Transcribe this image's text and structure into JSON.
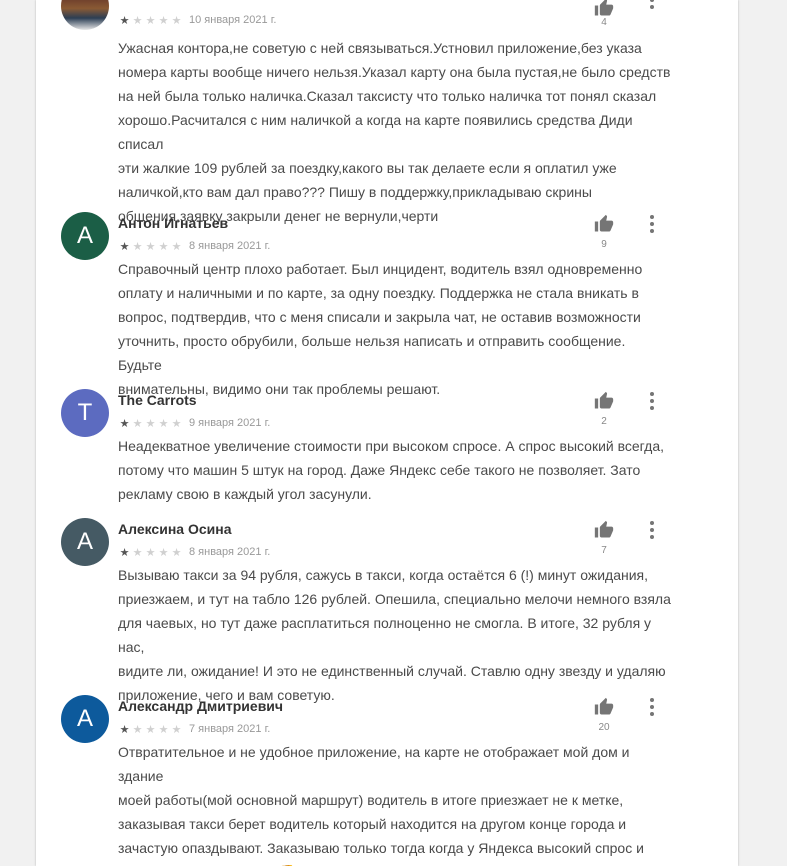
{
  "reviews": [
    {
      "author": "",
      "avatar_letter": "",
      "avatar_color": "#5a4a3a",
      "rating": 1,
      "date": "10 января 2021 г.",
      "helpful_count": "4",
      "text": "Ужасная контора,не советую с ней связываться.Устновил приложение,без указа\nномера карты вообще ничего нельзя.Указал карту она была пустая,не было средств\nна ней была только наличка.Сказал таксисту что только наличка тот понял сказал\nхорошо.Расчитался с ним наличкой а когда на карте появились средства Диди списал\nэти жалкие 109 рублей за поездку,какого вы так делаете если я оплатил уже\nналичкой,кто вам дал право??? Пишу в поддержку,прикладываю скрины\nобщения,заявку закрыли денег не вернули,черти"
    },
    {
      "author": "Антон Игнатьев",
      "avatar_letter": "А",
      "avatar_color": "#1b5e46",
      "rating": 1,
      "date": "8 января 2021 г.",
      "helpful_count": "9",
      "text": "Справочный центр плохо работает. Был инцидент, водитель взял одновременно\nоплату и наличными и по карте, за одну поездку. Поддержка не стала вникать в\nвопрос, подтвердив, что с меня списали и закрыла чат, не оставив возможности\nуточнить, просто обрубили, больше нельзя написать и отправить сообщение. Будьте\nвнимательны, видимо они так проблемы решают."
    },
    {
      "author": "The Carrots",
      "avatar_letter": "T",
      "avatar_color": "#5c6bc0",
      "rating": 1,
      "date": "9 января 2021 г.",
      "helpful_count": "2",
      "text": "Неадекватное увеличение стоимости при высоком спросе. А спрос высокий всегда,\nпотому что машин 5 штук на город. Даже Яндекс себе такого не позволяет. Зато\nрекламу свою в каждый угол засунули."
    },
    {
      "author": "Алексина Осина",
      "avatar_letter": "А",
      "avatar_color": "#455a64",
      "rating": 1,
      "date": "8 января 2021 г.",
      "helpful_count": "7",
      "text": "Вызываю такси за 94 рубля, сажусь в такси, когда остаётся 6 (!) минут ожидания,\nприезжаем, и тут на табло 126 рублей. Опешила, специально мелочи немного взяла\nдля чаевых, но тут даже расплатиться полноценно не смогла. В итоге, 32 рубля у нас,\nвидите ли, ожидание! И это не единственный случай. Ставлю одну звезду и удаляю\nприложение, чего и вам советую."
    },
    {
      "author": "Александр Дмитриевич",
      "avatar_letter": "А",
      "avatar_color": "#0d5a9c",
      "rating": 1,
      "date": "7 января 2021 г.",
      "helpful_count": "20",
      "text": "Отвратительное и не удобное приложение, на карте не отображает мой дом и здание\nмоей работы(мой основной маршрут) водитель в итоге приезжает не к метке,\nзаказывая такси берет водитель который находится на другом конце города и\nзачастую опаздывают. Заказываю только тогда когда у Яндекса высокий спрос и\nкогда сам не тороплюсь 👎"
    }
  ]
}
